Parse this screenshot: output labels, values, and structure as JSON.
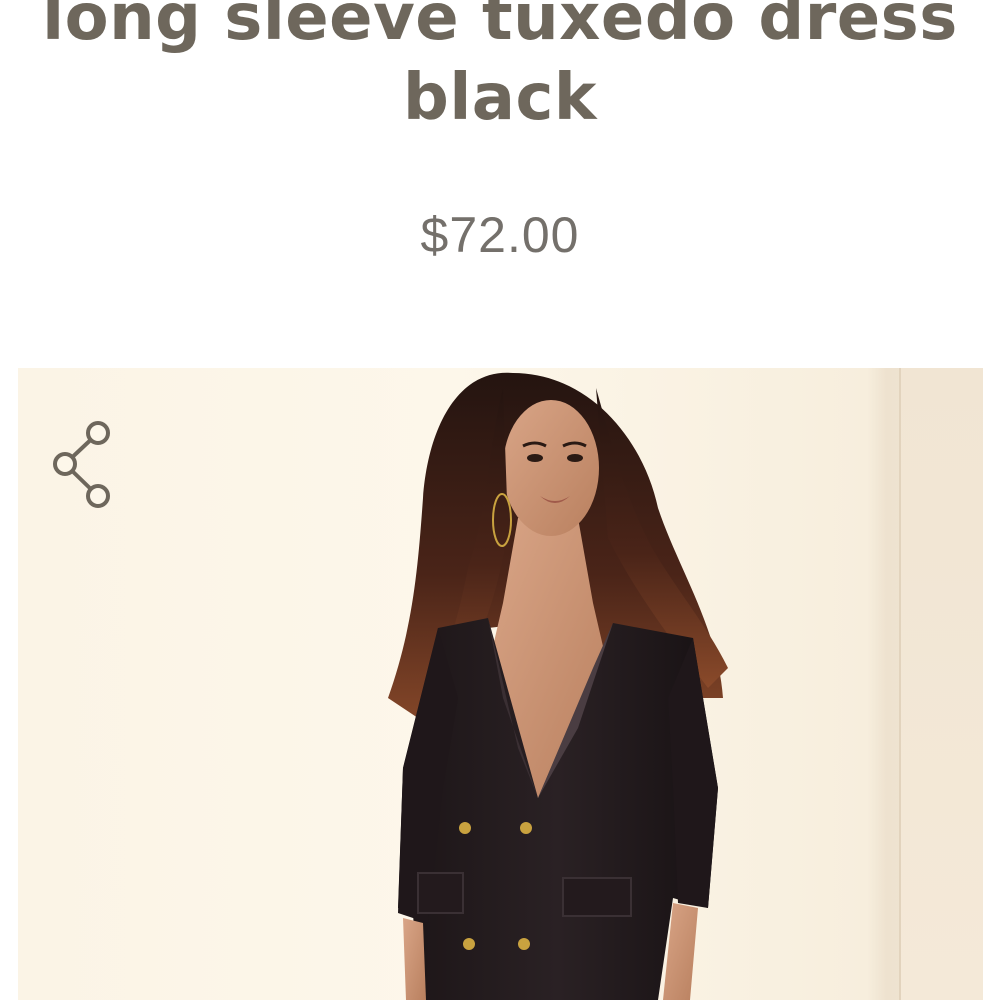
{
  "product": {
    "title_line1": "long sleeve tuxedo dress",
    "title_line2": "black",
    "price": "$72.00"
  },
  "icons": {
    "share": "share-icon"
  },
  "colors": {
    "title_text": "#6e675c",
    "price_text": "#74706b",
    "photo_background": "#fbf4e6"
  }
}
